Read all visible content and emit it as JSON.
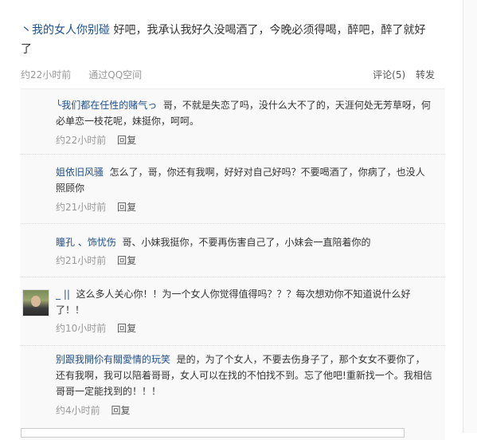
{
  "post": {
    "author": "丶我的女人你别碰",
    "text": "好吧，我承认我好久没喝酒了，今晚必须得喝，醉吧，醉了就好了",
    "time": "约22小时前",
    "source": "通过QQ空间",
    "comment_label": "评论(5)",
    "forward_label": "转发"
  },
  "reply_label": "回复",
  "comments": [
    {
      "author": "╰我们都在任性的赌气っ",
      "text": "哥，不就是失恋了吗，没什么大不了的，天涯何处无芳草呀，何必单恋一枝花呢，妹挺你，呵呵。",
      "time": "约22小时前"
    },
    {
      "author": "姐依旧风骚",
      "text": "怎么了，哥，你还有我啊，好好对自己好吗？不要喝酒了，你病了，也没人照顾你",
      "time": "约21小时前"
    },
    {
      "author": "瞳孔 、饰忧伤",
      "text": "哥、小妹我挺你，不要再伤害自己了，小妹会一直陪着你的",
      "time": "约21小时前"
    },
    {
      "author": "_ ||",
      "text": "这么多人关心你！！为一个女人你觉得值得吗？？？每次想劝你不知道说什么好了！！",
      "time": "约10小时前"
    },
    {
      "author": "别跟我開伱有關愛情的玩笑",
      "text": "是的，为了个女人，不要去伤身子了，那个女女不要你了，还有我啊，我可以陪着哥哥，女人可以在找的不怕找不到。忘了他吧!重新找一个。我相信哥哥一定能找到的！！！",
      "time": "约4小时前"
    }
  ]
}
